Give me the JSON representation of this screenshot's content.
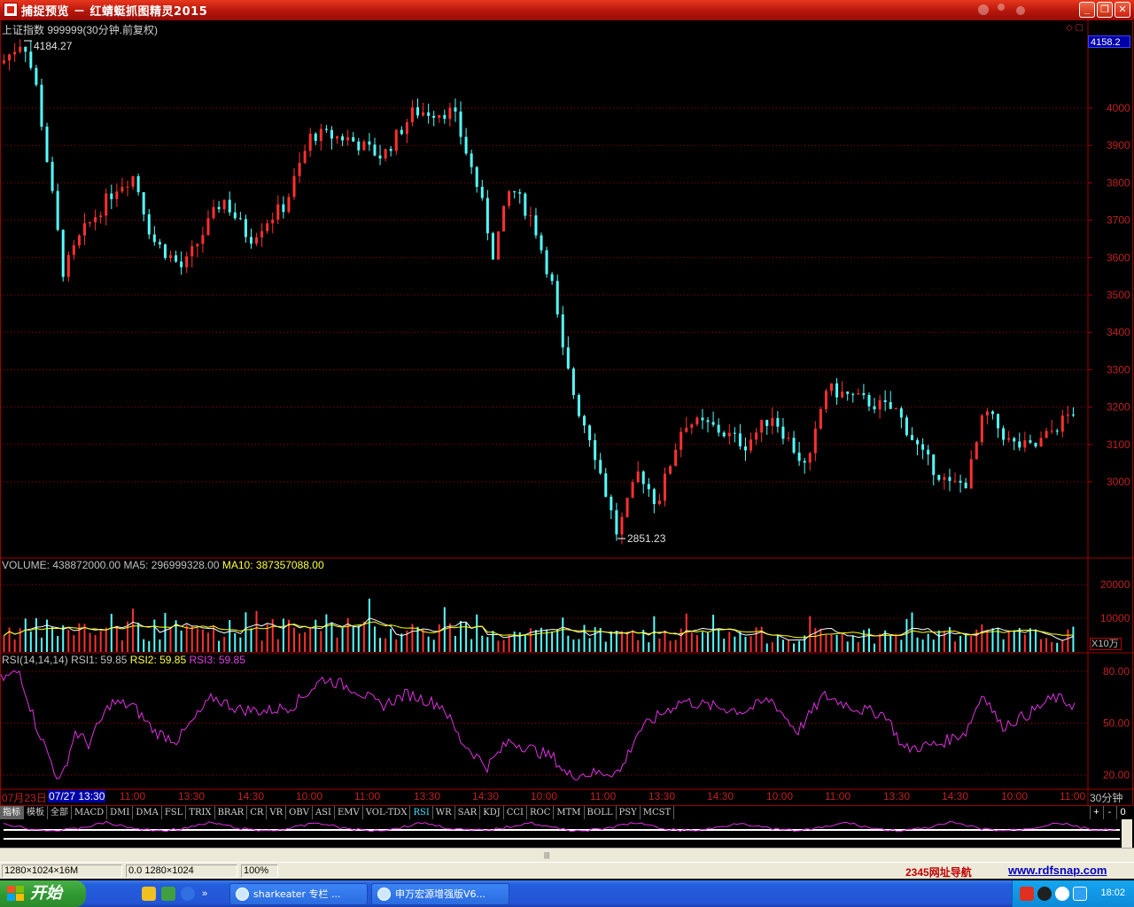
{
  "window": {
    "title": "捕捉预览 － 红蜻蜓抓图精灵2015",
    "minimize": "_",
    "restore": "❐",
    "close": "✕"
  },
  "chart": {
    "header": "上证指数 999999(30分钟.前复权)",
    "high_label": "4184.27",
    "low_label": "2851.23",
    "current_price": "4158.2",
    "price_ticks": [
      "4000",
      "3900",
      "3800",
      "3700",
      "3600",
      "3500",
      "3400",
      "3300",
      "3200",
      "3100",
      "3000"
    ],
    "volume_header": {
      "volume": "VOLUME: 438872000.00",
      "ma5": "MA5: 296999328.00",
      "ma10": "MA10: 387357088.00"
    },
    "volume_ticks": [
      "20000",
      "10000"
    ],
    "volume_unit": "X10万",
    "rsi_header": {
      "name": "RSI(14,14,14)",
      "rsi1": "RSI1: 59.85",
      "rsi2": "RSI2: 59.85",
      "rsi3": "RSI3: 59.85"
    },
    "rsi_ticks": [
      "80.00",
      "50.00",
      "20.00"
    ],
    "time_axis": {
      "start_date": "07月23日",
      "cursor": "07/27 13:30",
      "labels": [
        "11:00",
        "13:30",
        "14:30",
        "10:00",
        "11:00",
        "13:30",
        "14:30",
        "10:00",
        "11:00",
        "13:30",
        "14:30",
        "10:00",
        "11:00",
        "13:30",
        "14:30",
        "10:00",
        "11:00"
      ]
    },
    "period": "30分钟",
    "colors": {
      "up": "#ff3030",
      "down": "#54ffff",
      "ma5": "#ffffff",
      "ma10": "#ffff00",
      "rsi": "#e030e0",
      "grid": "#a00000"
    }
  },
  "tabs": {
    "items": [
      "指标",
      "模板",
      "全部",
      "MACD",
      "DMI",
      "DMA",
      "FSL",
      "TRIX",
      "BRAR",
      "CR",
      "VR",
      "OBV",
      "ASI",
      "EMV",
      "VOL-TDX",
      "RSI",
      "WR",
      "SAR",
      "KDJ",
      "CCI",
      "ROC",
      "MTM",
      "BOLL",
      "PSY",
      "MCST"
    ],
    "active": "RSI",
    "controls": [
      "+",
      "-",
      "0"
    ]
  },
  "statusbar": {
    "size": "1280×1024×16M",
    "coords": "0.0 1280×1024",
    "zoom": "100%",
    "nav": "2345网址导航",
    "site": "www.rdfsnap.com"
  },
  "taskbar": {
    "start": "开始",
    "tasks": [
      "sharkeater 专栏 ...",
      "申万宏源增强版V6..."
    ],
    "time": "18:02"
  }
}
